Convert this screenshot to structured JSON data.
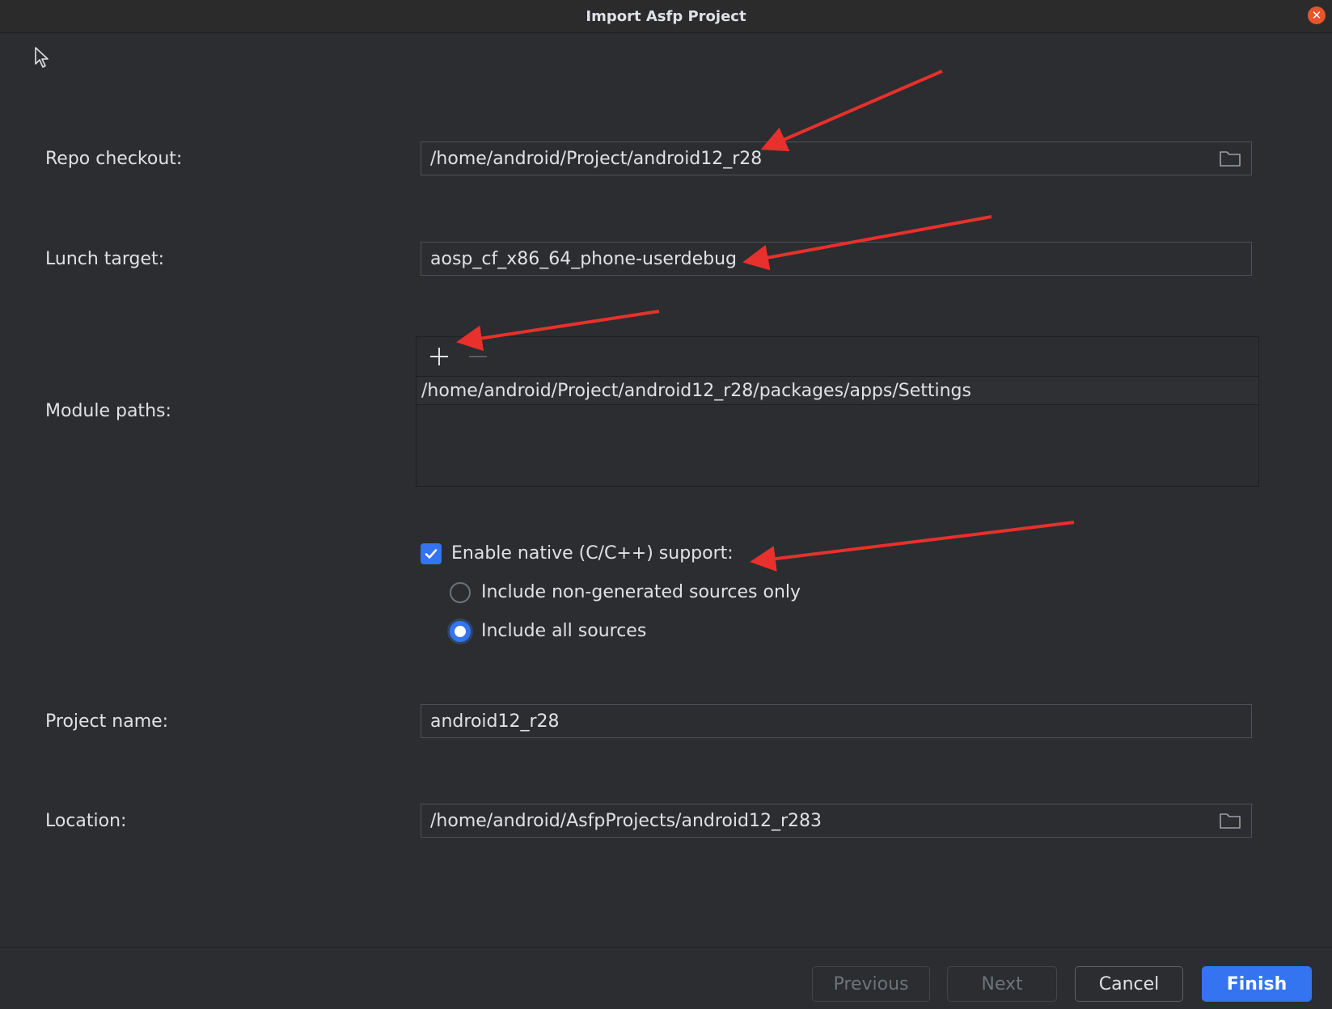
{
  "window": {
    "title": "Import Asfp Project",
    "close_icon": "close-icon",
    "close_color": "#e9542a"
  },
  "form": {
    "repo_checkout": {
      "label": "Repo checkout:",
      "value": "/home/android/Project/android12_r28",
      "icon": "folder-icon"
    },
    "lunch_target": {
      "label": "Lunch target:",
      "value": "aosp_cf_x86_64_phone-userdebug"
    },
    "module_paths": {
      "label": "Module paths:",
      "add_icon": "plus-icon",
      "remove_icon": "minus-icon",
      "items": [
        "/home/android/Project/android12_r28/packages/apps/Settings"
      ]
    },
    "native_support": {
      "label": "Enable native (C/C++) support:",
      "checked": true,
      "options": [
        {
          "label": "Include non-generated sources only",
          "selected": false
        },
        {
          "label": "Include all sources",
          "selected": true
        }
      ]
    },
    "project_name": {
      "label": "Project name:",
      "value": "android12_r28"
    },
    "location": {
      "label": "Location:",
      "value": "/home/android/AsfpProjects/android12_r283",
      "icon": "folder-icon"
    }
  },
  "footer": {
    "previous_label": "Previous",
    "next_label": "Next",
    "cancel_label": "Cancel",
    "finish_label": "Finish"
  },
  "theme": {
    "accent": "#3574f0",
    "background": "#2b2d30",
    "annotation_arrow": "#e8302c"
  }
}
